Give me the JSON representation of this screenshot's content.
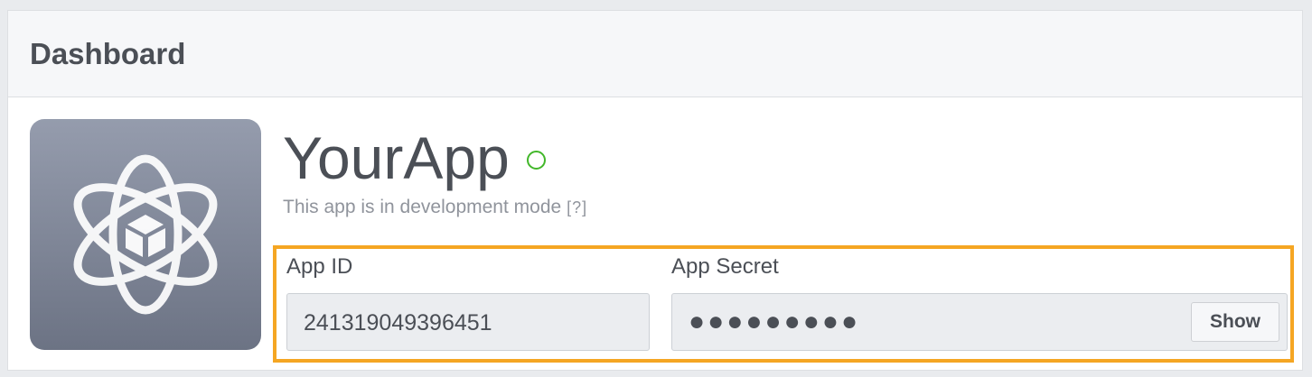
{
  "panel": {
    "title": "Dashboard"
  },
  "app": {
    "name": "YourApp",
    "status_color": "#42b72a",
    "status_text": "This app is in development mode",
    "help_text": "[?]",
    "icon": "atom-cube-icon"
  },
  "credentials": {
    "app_id_label": "App ID",
    "app_id_value": "241319049396451",
    "app_secret_label": "App Secret",
    "app_secret_masked": "●●●●●●●●●",
    "show_button_label": "Show",
    "highlight_color": "#f5a623"
  }
}
